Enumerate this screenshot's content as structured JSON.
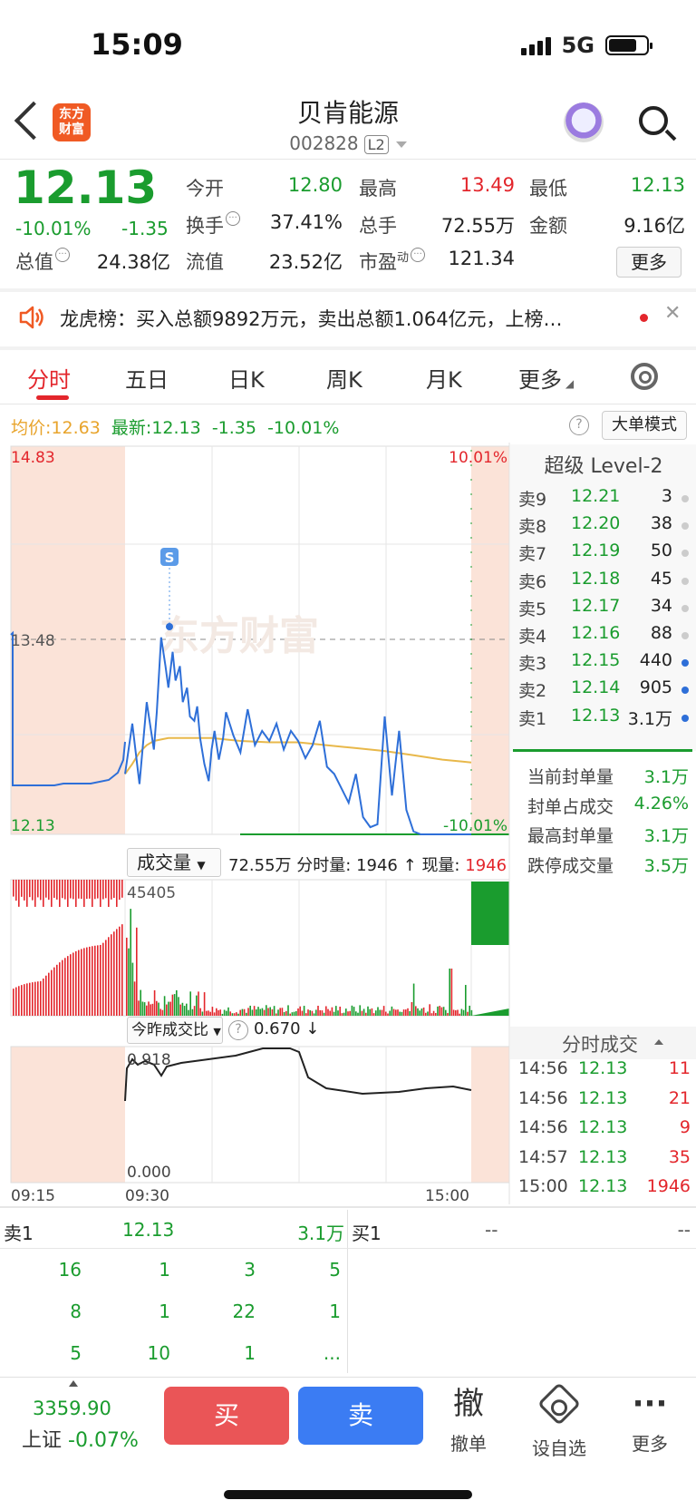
{
  "status_bar": {
    "time": "15:09",
    "network": "5G"
  },
  "header": {
    "app_logo": "东方\n财富",
    "stock_name": "贝肯能源",
    "stock_code": "002828",
    "level_badge": "L2"
  },
  "quote": {
    "price": "12.13",
    "pct": "-10.01%",
    "change": "-1.35",
    "open_label": "今开",
    "open": "12.80",
    "high_label": "最高",
    "high": "13.49",
    "low_label": "最低",
    "low": "12.13",
    "turnover_label": "换手",
    "turnover": "37.41%",
    "volume_label": "总手",
    "volume": "72.55万",
    "amount_label": "金额",
    "amount": "9.16亿",
    "mktcap_label": "总值",
    "mktcap": "24.38亿",
    "float_label": "流值",
    "float": "23.52亿",
    "pe_label": "市盈",
    "pe_sup": "动",
    "pe": "121.34",
    "more_button": "更多"
  },
  "news": {
    "text": "龙虎榜：买入总额9892万元，卖出总额1.064亿元，上榜…"
  },
  "tabs": [
    "分时",
    "五日",
    "日K",
    "周K",
    "月K",
    "更多"
  ],
  "price_line": {
    "avg_label": "均价:",
    "avg": "12.63",
    "latest_label": "最新:",
    "latest": "12.13",
    "change": "-1.35",
    "pct": "-10.01%",
    "mode_button": "大单模式"
  },
  "chart_data": {
    "type": "line",
    "y_top_label": "14.83",
    "y_mid_label": "13.48",
    "y_bottom_label": "12.13",
    "pct_top_label": "10.01%",
    "pct_bottom_label": "-10.01%",
    "signal_marker": "S",
    "watermark": "东方财富",
    "x_labels": [
      "09:15",
      "09:30",
      "15:00"
    ],
    "ylim": [
      12.13,
      14.83
    ],
    "price_series": {
      "x_minutes": [
        0,
        5,
        10,
        15,
        20,
        22,
        25,
        28,
        30,
        33,
        35,
        38,
        40,
        43,
        45,
        48,
        50,
        52,
        55,
        58,
        60,
        62,
        65,
        68,
        70,
        75,
        80,
        85,
        90,
        95,
        100,
        105,
        110,
        115,
        120,
        125,
        130,
        135,
        140,
        145,
        150,
        155,
        160,
        165,
        170,
        175,
        180,
        185,
        190,
        195,
        200,
        205,
        210,
        215,
        220,
        225,
        230,
        235,
        240
      ],
      "values": [
        12.55,
        12.9,
        12.48,
        13.05,
        12.72,
        12.98,
        13.5,
        13.3,
        13.15,
        13.4,
        13.2,
        13.3,
        13.05,
        13.15,
        12.95,
        12.92,
        13.02,
        12.8,
        12.62,
        12.5,
        12.72,
        12.85,
        12.65,
        12.8,
        12.98,
        12.82,
        12.7,
        13.0,
        12.75,
        12.85,
        12.78,
        12.9,
        12.72,
        12.85,
        12.78,
        12.66,
        12.75,
        12.92,
        12.6,
        12.55,
        12.45,
        12.35,
        12.55,
        12.25,
        12.18,
        12.2,
        12.95,
        12.4,
        12.85,
        12.3,
        12.15,
        12.13,
        12.13,
        12.13,
        12.13,
        12.13,
        12.13,
        12.13,
        12.13
      ]
    },
    "avg_series": {
      "x_minutes": [
        0,
        5,
        10,
        15,
        20,
        30,
        40,
        60,
        80,
        100,
        120,
        140,
        160,
        180,
        200,
        220,
        240
      ],
      "values": [
        12.55,
        12.62,
        12.7,
        12.75,
        12.78,
        12.8,
        12.8,
        12.8,
        12.78,
        12.77,
        12.77,
        12.75,
        12.73,
        12.71,
        12.68,
        12.65,
        12.63
      ]
    }
  },
  "volume_bar": {
    "select_label": "成交量",
    "total": "72.55万",
    "minute_label": "分时量:",
    "minute_value": "1946 ↑",
    "now_label": "现量:",
    "now_value": "1946",
    "max_label": "45405"
  },
  "ratio_bar": {
    "select_label": "今昨成交比",
    "value": "0.670 ↓",
    "top_label": "0.918",
    "bottom_label": "0.000"
  },
  "order_book": {
    "title": "超级 Level-2",
    "asks": [
      {
        "label": "卖9",
        "price": "12.21",
        "vol": "3",
        "dot": "#cccccc"
      },
      {
        "label": "卖8",
        "price": "12.20",
        "vol": "38",
        "dot": "#cccccc"
      },
      {
        "label": "卖7",
        "price": "12.19",
        "vol": "50",
        "dot": "#cccccc"
      },
      {
        "label": "卖6",
        "price": "12.18",
        "vol": "45",
        "dot": "#cccccc"
      },
      {
        "label": "卖5",
        "price": "12.17",
        "vol": "34",
        "dot": "#cccccc"
      },
      {
        "label": "卖4",
        "price": "12.16",
        "vol": "88",
        "dot": "#cccccc"
      },
      {
        "label": "卖3",
        "price": "12.15",
        "vol": "440",
        "dot": "#2e6fd8"
      },
      {
        "label": "卖2",
        "price": "12.14",
        "vol": "905",
        "dot": "#2e6fd8"
      },
      {
        "label": "卖1",
        "price": "12.13",
        "vol": "3.1万",
        "dot": "#2e6fd8"
      }
    ],
    "seal": [
      {
        "k": "当前封单量",
        "v": "3.1万"
      },
      {
        "k": "封单占成交",
        "v": "4.26%"
      },
      {
        "k": "最高封单量",
        "v": "3.1万"
      },
      {
        "k": "跌停成交量",
        "v": "3.5万"
      }
    ]
  },
  "ticks": {
    "title": "分时成交",
    "rows": [
      {
        "t": "14:56",
        "p": "12.13",
        "v": "11"
      },
      {
        "t": "14:56",
        "p": "12.13",
        "v": "21"
      },
      {
        "t": "14:56",
        "p": "12.13",
        "v": "9"
      },
      {
        "t": "14:57",
        "p": "12.13",
        "v": "35"
      },
      {
        "t": "15:00",
        "p": "12.13",
        "v": "1946"
      }
    ]
  },
  "book_bottom": {
    "sell1_label": "卖1",
    "sell1_price": "12.13",
    "sell1_vol": "3.1万",
    "buy1_label": "买1",
    "buy1_price": "--",
    "buy1_vol": "--",
    "queue": [
      [
        "16",
        "1",
        "3",
        "5"
      ],
      [
        "8",
        "1",
        "22",
        "1"
      ],
      [
        "5",
        "10",
        "1",
        "..."
      ]
    ]
  },
  "bottom_bar": {
    "index_value": "3359.90",
    "index_name": "上证",
    "index_pct": "-0.07%",
    "buy": "买",
    "sell": "卖",
    "cancel_glyph": "撤",
    "cancel_label": "撤单",
    "watch_label": "设自选",
    "more_glyph": "···",
    "more_label": "更多"
  }
}
